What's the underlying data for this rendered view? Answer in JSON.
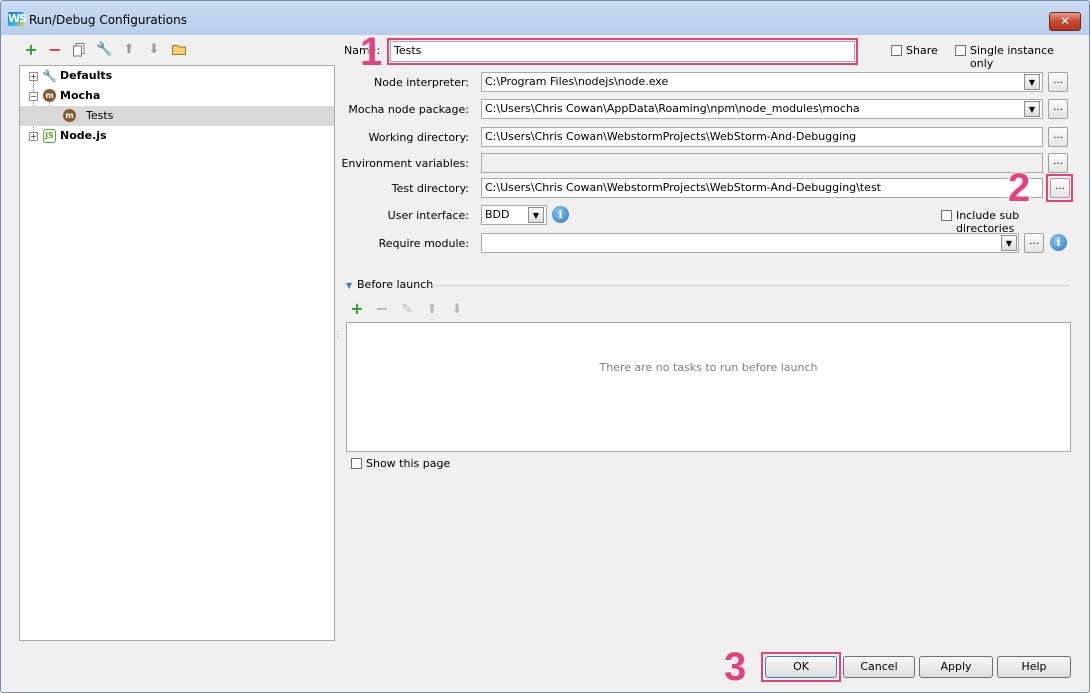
{
  "window": {
    "title": "Run/Debug Configurations",
    "app_icon_text": "WS",
    "close_label": "✕"
  },
  "left_toolbar": {
    "icons": [
      "add-icon",
      "remove-icon",
      "copy-icon",
      "wrench-icon",
      "move-up-icon",
      "move-down-icon",
      "folder-icon"
    ]
  },
  "tree": {
    "items": [
      {
        "label": "Defaults",
        "expander": "+"
      },
      {
        "label": "Mocha",
        "expander": "−",
        "icon_text": "m"
      },
      {
        "label": "Tests",
        "icon_text": "m"
      },
      {
        "label": "Node.js",
        "expander": "+",
        "icon_text": "JS"
      }
    ]
  },
  "form": {
    "name_label": "Name:",
    "name_value": "Tests",
    "share_label": "Share",
    "single_instance_label": "Single instance only",
    "node_interpreter_label": "Node interpreter:",
    "node_interpreter_value": "C:\\Program Files\\nodejs\\node.exe",
    "mocha_package_label": "Mocha node package:",
    "mocha_package_value": "C:\\Users\\Chris Cowan\\AppData\\Roaming\\npm\\node_modules\\mocha",
    "working_dir_label": "Working directory:",
    "working_dir_value": "C:\\Users\\Chris Cowan\\WebstormProjects\\WebStorm-And-Debugging",
    "env_vars_label": "Environment variables:",
    "env_vars_value": "",
    "test_dir_label": "Test directory:",
    "test_dir_value": "C:\\Users\\Chris Cowan\\WebstormProjects\\WebStorm-And-Debugging\\test",
    "ui_label": "User interface:",
    "ui_value": "BDD",
    "include_sub_label": "Include sub directories",
    "require_label": "Require module:",
    "require_value": "",
    "browse_label": "...",
    "info_label": "i"
  },
  "before_launch": {
    "title": "Before launch",
    "empty_text": "There are no tasks to run before launch",
    "show_page_label": "Show this page"
  },
  "buttons": {
    "ok": "OK",
    "cancel": "Cancel",
    "apply": "Apply",
    "help": "Help"
  },
  "annotations": {
    "one": "1",
    "two": "2",
    "three": "3"
  },
  "colors": {
    "highlight": "#e6407f",
    "selection": "#d9d9d9"
  }
}
